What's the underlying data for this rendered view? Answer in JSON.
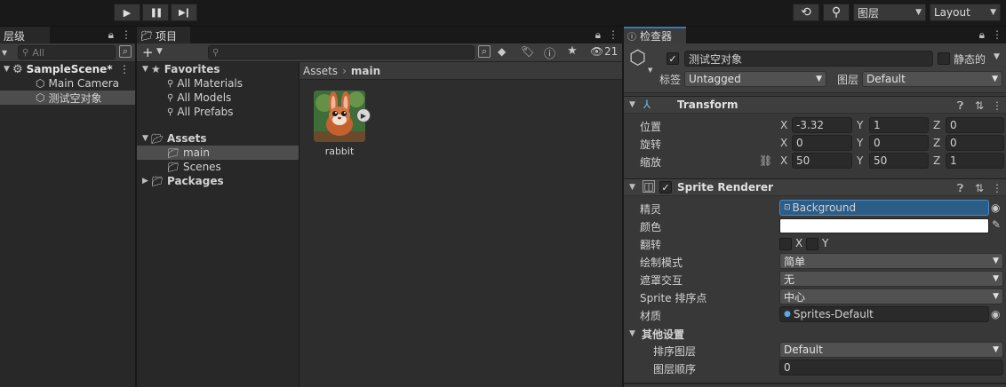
{
  "toolbar": {
    "play_icon": "▶",
    "pause_icon": "❚❚",
    "step_icon": "▶❙",
    "history_icon": "⟲",
    "search_icon": "⚲",
    "layers_label": "图层",
    "layout_label": "Layout"
  },
  "hierarchy": {
    "tab_label": "层级",
    "search_placeholder": "All",
    "scene_name": "SampleScene*",
    "items": [
      {
        "label": "Main Camera"
      },
      {
        "label": "测试空对象"
      }
    ]
  },
  "project": {
    "tab_label": "项目",
    "add_label": "+",
    "hidden_count": "21",
    "favorites_label": "Favorites",
    "favorites": [
      {
        "label": "All Materials"
      },
      {
        "label": "All Models"
      },
      {
        "label": "All Prefabs"
      }
    ],
    "assets_label": "Assets",
    "asset_folders": [
      {
        "label": "main"
      },
      {
        "label": "Scenes"
      }
    ],
    "packages_label": "Packages",
    "breadcrumb": {
      "root": "Assets",
      "separator": "›",
      "current": "main"
    },
    "asset_items": [
      {
        "label": "rabbit"
      }
    ]
  },
  "inspector": {
    "tab_label": "检查器",
    "object_name": "测试空对象",
    "static_label": "静态的",
    "tag_label": "标签",
    "tag_value": "Untagged",
    "layer_label": "图层",
    "layer_value": "Default",
    "transform": {
      "title": "Transform",
      "position_label": "位置",
      "rotation_label": "旋转",
      "scale_label": "缩放",
      "axis_x": "X",
      "axis_y": "Y",
      "axis_z": "Z",
      "position": {
        "x": "-3.32",
        "y": "1",
        "z": "0"
      },
      "rotation": {
        "x": "0",
        "y": "0",
        "z": "0"
      },
      "scale": {
        "x": "50",
        "y": "50",
        "z": "1"
      }
    },
    "sprite_renderer": {
      "title": "Sprite Renderer",
      "sprite_label": "精灵",
      "sprite_value": "Background",
      "color_label": "颜色",
      "color_value": "#ffffff",
      "flip_label": "翻转",
      "flip_x": "X",
      "flip_y": "Y",
      "draw_mode_label": "绘制模式",
      "draw_mode_value": "简单",
      "mask_label": "遮罩交互",
      "mask_value": "无",
      "sort_point_label": "Sprite 排序点",
      "sort_point_value": "中心",
      "material_label": "材质",
      "material_value": "Sprites-Default",
      "additional_label": "其他设置",
      "sorting_layer_label": "排序图层",
      "sorting_layer_value": "Default",
      "order_label": "图层顺序",
      "order_value": "0"
    }
  },
  "colors": {
    "accent": "#3a79bb",
    "selection": "#2c5d87",
    "panel_bg": "#282828",
    "header_bg": "#3c3c3c"
  }
}
